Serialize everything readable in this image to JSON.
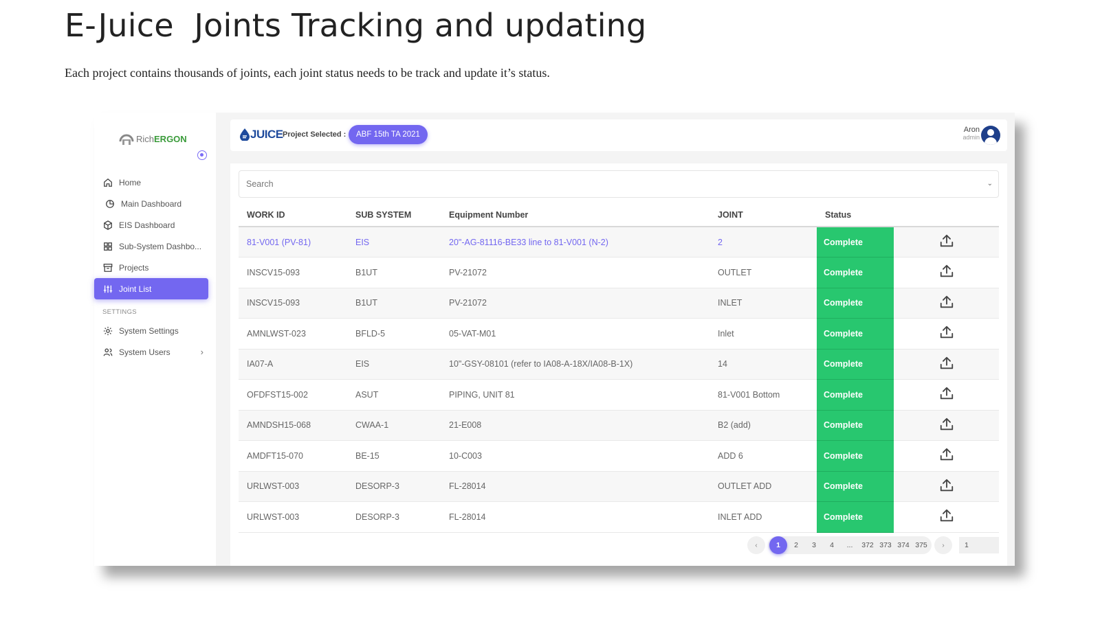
{
  "slide": {
    "title": "E-Juice  Joints Tracking and updating",
    "subtitle": "Each project contains thousands of joints, each joint status needs to be track and update it’s status."
  },
  "logo": {
    "prefix": "Rich",
    "accent": "ERGON"
  },
  "sidebar": {
    "items": [
      {
        "label": "Home",
        "icon": "home-icon"
      },
      {
        "label": "Main Dashboard",
        "icon": "pie-chart-icon"
      },
      {
        "label": "EIS Dashboard",
        "icon": "box-icon"
      },
      {
        "label": "Sub-System Dashbo...",
        "icon": "grid-icon"
      },
      {
        "label": "Projects",
        "icon": "archive-icon"
      },
      {
        "label": "Joint List",
        "icon": "sliders-icon",
        "active": true
      }
    ],
    "settings_label": "SETTINGS",
    "settings_items": [
      {
        "label": "System Settings",
        "icon": "gear-icon"
      },
      {
        "label": "System Users",
        "icon": "users-icon"
      }
    ]
  },
  "header": {
    "brand": "JUICE",
    "project_label": "Project Selected :",
    "project_value": "ABF 15th TA 2021",
    "user_name": "Aron",
    "user_role": "admin"
  },
  "search": {
    "placeholder": "Search"
  },
  "table": {
    "columns": [
      "WORK ID",
      "SUB SYSTEM",
      "Equipment Number",
      "JOINT",
      "Status"
    ],
    "rows": [
      {
        "work_id": "81-V001 (PV-81)",
        "sub_system": "EIS",
        "equipment": "20\"-AG-81116-BE33 line to 81-V001 (N-2)",
        "joint": "2",
        "status": "Complete"
      },
      {
        "work_id": "INSCV15-093",
        "sub_system": "B1UT",
        "equipment": "PV-21072",
        "joint": "OUTLET",
        "status": "Complete"
      },
      {
        "work_id": "INSCV15-093",
        "sub_system": "B1UT",
        "equipment": "PV-21072",
        "joint": "INLET",
        "status": "Complete"
      },
      {
        "work_id": "AMNLWST-023",
        "sub_system": "BFLD-5",
        "equipment": "05-VAT-M01",
        "joint": "Inlet",
        "status": "Complete"
      },
      {
        "work_id": "IA07-A",
        "sub_system": "EIS",
        "equipment": "10\"-GSY-08101 (refer to IA08-A-18X/IA08-B-1X)",
        "joint": "14",
        "status": "Complete"
      },
      {
        "work_id": "OFDFST15-002",
        "sub_system": "ASUT",
        "equipment": "PIPING, UNIT 81",
        "joint": "81-V001 Bottom",
        "status": "Complete"
      },
      {
        "work_id": "AMNDSH15-068",
        "sub_system": "CWAA-1",
        "equipment": "21-E008",
        "joint": "B2 (add)",
        "status": "Complete"
      },
      {
        "work_id": "AMDFT15-070",
        "sub_system": "BE-15",
        "equipment": "10-C003",
        "joint": "ADD 6",
        "status": "Complete"
      },
      {
        "work_id": "URLWST-003",
        "sub_system": "DESORP-3",
        "equipment": "FL-28014",
        "joint": "OUTLET ADD",
        "status": "Complete"
      },
      {
        "work_id": "URLWST-003",
        "sub_system": "DESORP-3",
        "equipment": "FL-28014",
        "joint": "INLET ADD",
        "status": "Complete"
      }
    ]
  },
  "pagination": {
    "prev": "‹",
    "next": "›",
    "pages": [
      "1",
      "2",
      "3",
      "4",
      "...",
      "372",
      "373",
      "374",
      "375"
    ],
    "current": "1",
    "jump_value": "1"
  },
  "colors": {
    "accent": "#7367f0",
    "status_complete": "#28c76f",
    "brand": "#1e4a9c"
  }
}
